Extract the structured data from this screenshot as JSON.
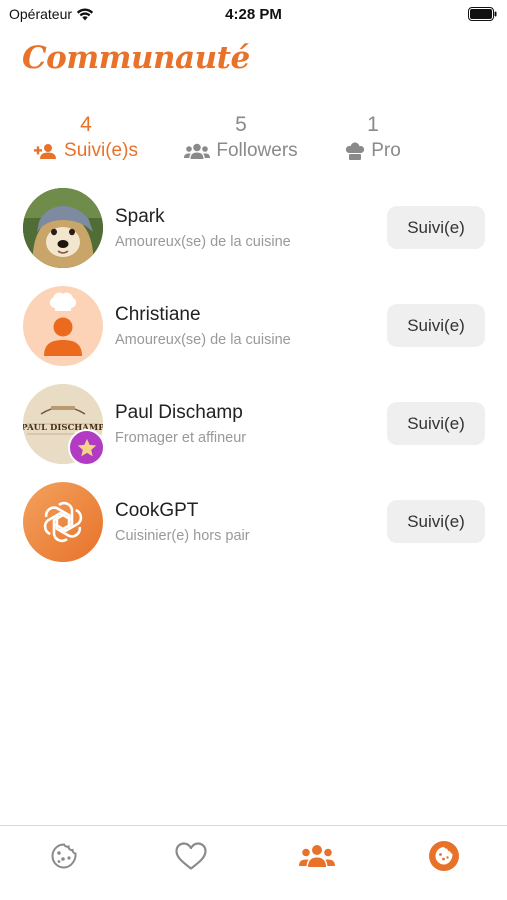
{
  "status_bar": {
    "carrier": "Opérateur",
    "time": "4:28 PM"
  },
  "header": {
    "title": "Communauté"
  },
  "tabs": [
    {
      "count": "4",
      "label": "Suivi(e)s",
      "icon": "add-user-icon",
      "active": true
    },
    {
      "count": "5",
      "label": "Followers",
      "icon": "users-icon",
      "active": false
    },
    {
      "count": "1",
      "label": "Pro",
      "icon": "chef-hat-icon",
      "active": false
    }
  ],
  "users": [
    {
      "name": "Spark",
      "subtitle": "Amoureux(se) de la cuisine",
      "button": "Suivi(e)",
      "avatar": "dog-photo",
      "pro": false
    },
    {
      "name": "Christiane",
      "subtitle": "Amoureux(se) de la cuisine",
      "button": "Suivi(e)",
      "avatar": "chef-placeholder",
      "pro": false
    },
    {
      "name": "Paul Dischamp",
      "subtitle": "Fromager et affineur",
      "button": "Suivi(e)",
      "avatar": "paul-dischamp-logo",
      "avatar_text": "PAUL DISCHAMP",
      "pro": true
    },
    {
      "name": "CookGPT",
      "subtitle": "Cuisinier(e) hors pair",
      "button": "Suivi(e)",
      "avatar": "openai-logo",
      "pro": false
    }
  ],
  "tab_bar": [
    {
      "icon": "cookie-icon",
      "active": false
    },
    {
      "icon": "heart-icon",
      "active": false
    },
    {
      "icon": "community-icon",
      "active": true
    },
    {
      "icon": "profile-icon",
      "active": false
    }
  ],
  "colors": {
    "accent": "#E8722A",
    "inactive": "#8a8a8a",
    "pro_badge": "#B23BC4"
  }
}
